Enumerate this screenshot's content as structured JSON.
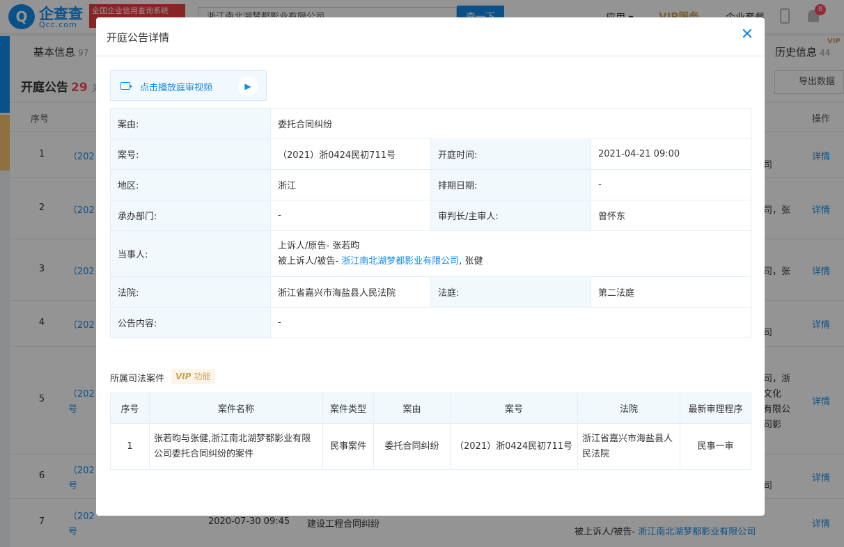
{
  "header": {
    "logo_text": "企查查",
    "logo_sub": "Qcc.com",
    "slogan": "全国企业信用查询系统",
    "search_value": "浙江南北湖梦都影业有限公司",
    "search_button": "查一下",
    "nav_app": "应用 ▾",
    "nav_vip": "VIP服务",
    "nav_enterprise": "企业套餐",
    "notification_count": "8"
  },
  "tabs": {
    "basic_label": "基本信息",
    "basic_count": "97",
    "history_label": "历史信息",
    "history_count": "44",
    "vip_tag": "VIP"
  },
  "section": {
    "title": "开庭公告",
    "count": "29",
    "title_suffix": "关",
    "export_label": "导出数据"
  },
  "bg_table": {
    "seq_header": "序号",
    "action_header": "操作",
    "rows": [
      {
        "seq": "1",
        "case": "（202",
        "detail": "详情",
        "side": "司"
      },
      {
        "seq": "2",
        "case": "（202",
        "detail": "详情",
        "side": "司，张"
      },
      {
        "seq": "3",
        "case": "（202",
        "detail": "详情",
        "side": "司，张"
      },
      {
        "seq": "4",
        "case": "（202",
        "detail": "详情",
        "side": "司"
      },
      {
        "seq": "5",
        "case": "（202",
        "case2": "号",
        "detail": "详情",
        "side": "司，浙",
        "side2": "文化",
        "side3": "有限公",
        "side4": "司影"
      },
      {
        "seq": "6",
        "case": "（202",
        "case2": "号",
        "detail": "详情",
        "side": "司"
      },
      {
        "seq": "7",
        "case": "（202",
        "case2": "号",
        "date": "2020-07-30 09:45",
        "reason": "建设工程合同纠纷",
        "party": "被上诉人/被告-",
        "party_company": "浙江南北湖梦都影业有限公司",
        "detail": "详情"
      }
    ]
  },
  "modal": {
    "title": "开庭公告详情",
    "video_label": "点击播放庭审视频",
    "fields": {
      "case_reason_label": "案由:",
      "case_reason": "委托合同纠纷",
      "case_no_label": "案号:",
      "case_no": "（2021）浙0424民初711号",
      "hearing_time_label": "开庭时间:",
      "hearing_time": "2021-04-21 09:00",
      "region_label": "地区:",
      "region": "浙江",
      "schedule_date_label": "排期日期:",
      "schedule_date": "-",
      "dept_label": "承办部门:",
      "dept": "-",
      "judge_label": "审判长/主审人:",
      "judge": "曾怀东",
      "parties_label": "当事人:",
      "plaintiff_line": "上诉人/原告- 张若昀",
      "defendant_prefix": "被上诉人/被告-",
      "defendant_company": "浙江南北湖梦都影业有限公司",
      "defendant_suffix": ", 张健",
      "court_label": "法院:",
      "court": "浙江省嘉兴市海盐县人民法院",
      "courtroom_label": "法庭:",
      "courtroom": "第二法庭",
      "content_label": "公告内容:",
      "content": "-"
    },
    "related": {
      "title": "所属司法案件",
      "vip_badge": "VIP",
      "vip_text": "功能",
      "headers": [
        "序号",
        "案件名称",
        "案件类型",
        "案由",
        "案号",
        "法院",
        "最新审理程序"
      ],
      "rows": [
        {
          "seq": "1",
          "name": "张若昀与张健,浙江南北湖梦都影业有限公司委托合同纠纷的案件",
          "type": "民事案件",
          "reason": "委托合同纠纷",
          "case_no": "（2021）浙0424民初711号",
          "court": "浙江省嘉兴市海盐县人民法院",
          "procedure": "民事一审"
        }
      ]
    }
  }
}
